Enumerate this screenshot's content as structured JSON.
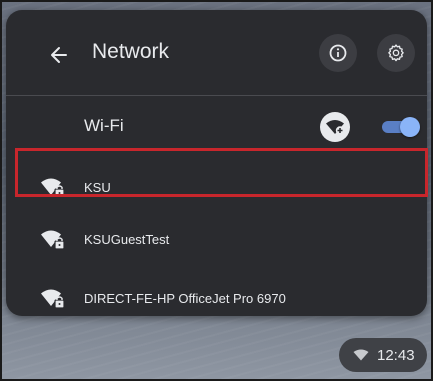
{
  "header": {
    "title": "Network",
    "back_icon": "arrow-left-icon",
    "info_icon": "info-icon",
    "settings_icon": "gear-icon"
  },
  "wifi": {
    "label": "Wi-Fi",
    "enabled": true,
    "add_icon": "wifi-add-icon",
    "accent": "#8ab4f8"
  },
  "networks": [
    {
      "name": "KSU",
      "icon": "wifi-lock-icon",
      "selected": true
    },
    {
      "name": "KSUGuestTest",
      "icon": "wifi-lock-icon",
      "selected": false
    },
    {
      "name": "DIRECT-FE-HP OfficeJet Pro 6970",
      "icon": "wifi-lock-icon",
      "selected": false
    }
  ],
  "highlight_color": "#c8262c",
  "shelf": {
    "time": "12:43",
    "status_icon": "wifi-status-icon"
  }
}
